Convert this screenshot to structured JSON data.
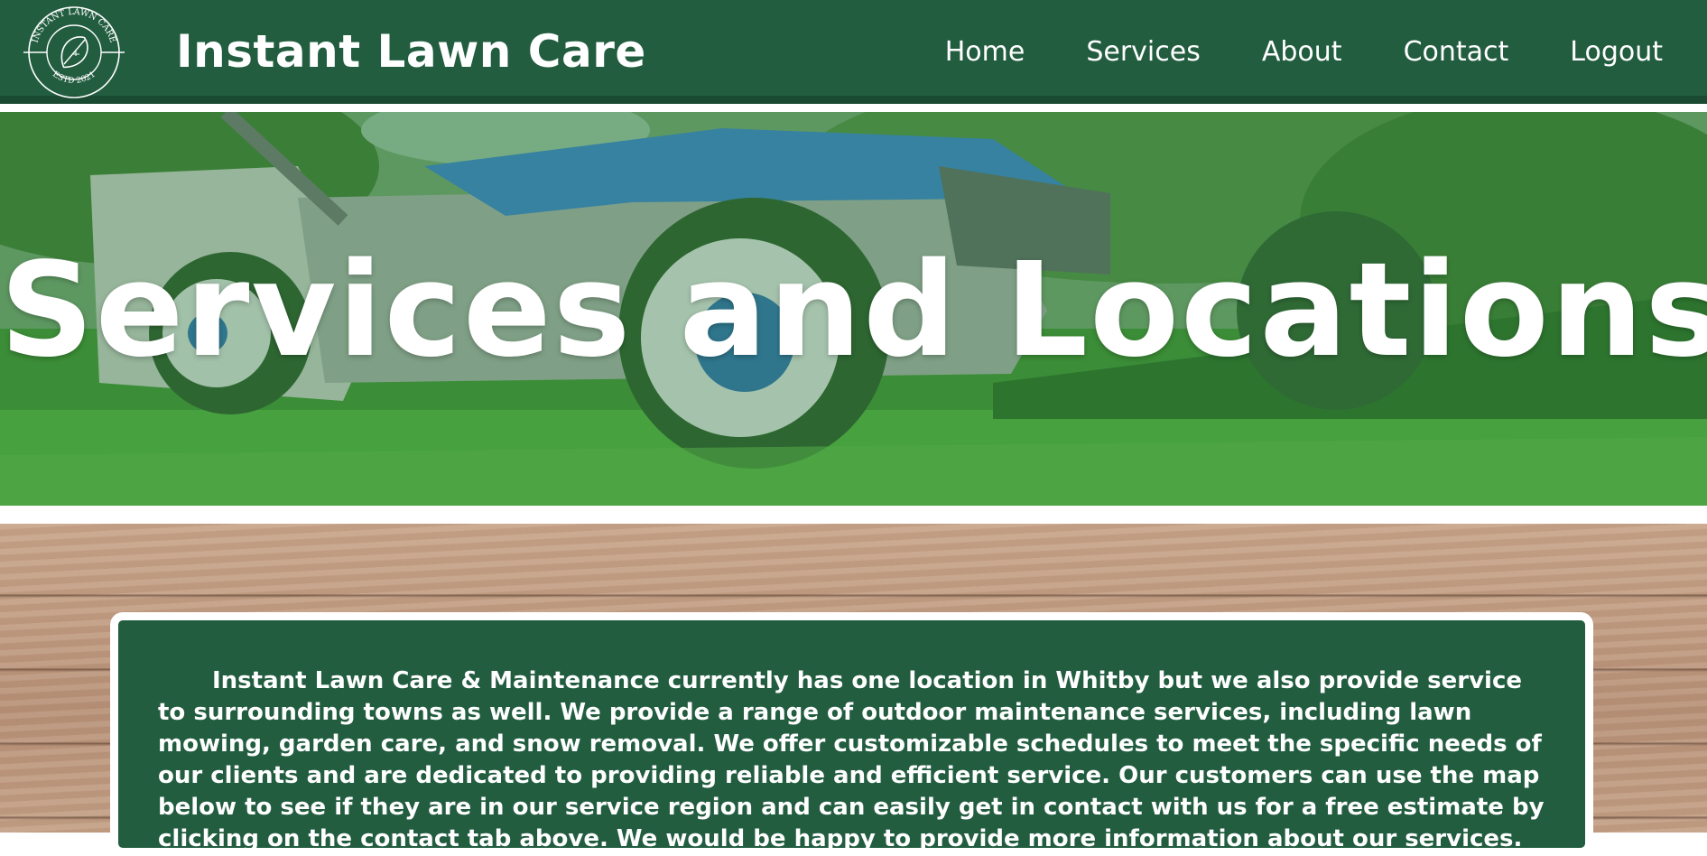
{
  "header": {
    "logo": {
      "icon": "leaf-icon",
      "top_text": "INSTANT LAWN CARE",
      "bottom_text": "ESTD 2021"
    },
    "brand": "Instant Lawn Care",
    "nav": [
      {
        "label": "Home"
      },
      {
        "label": "Services"
      },
      {
        "label": "About"
      },
      {
        "label": "Contact"
      },
      {
        "label": "Logout"
      }
    ],
    "colors": {
      "primary": "#225d40",
      "text": "#ffffff"
    }
  },
  "hero": {
    "title": "Services and Locations"
  },
  "content": {
    "paragraph": "Instant Lawn Care & Maintenance currently has one location in Whitby but we also provide service to surrounding towns as well. We provide a range of outdoor maintenance services, including lawn mowing, garden care, and snow removal. We offer customizable schedules to meet the specific needs of our clients and are dedicated to providing reliable and efficient service. Our customers can use the map below to see if they are in our service region and can easily get in contact with us for a free estimate by clicking on the contact tab above. We would be happy to provide more information about our services."
  }
}
